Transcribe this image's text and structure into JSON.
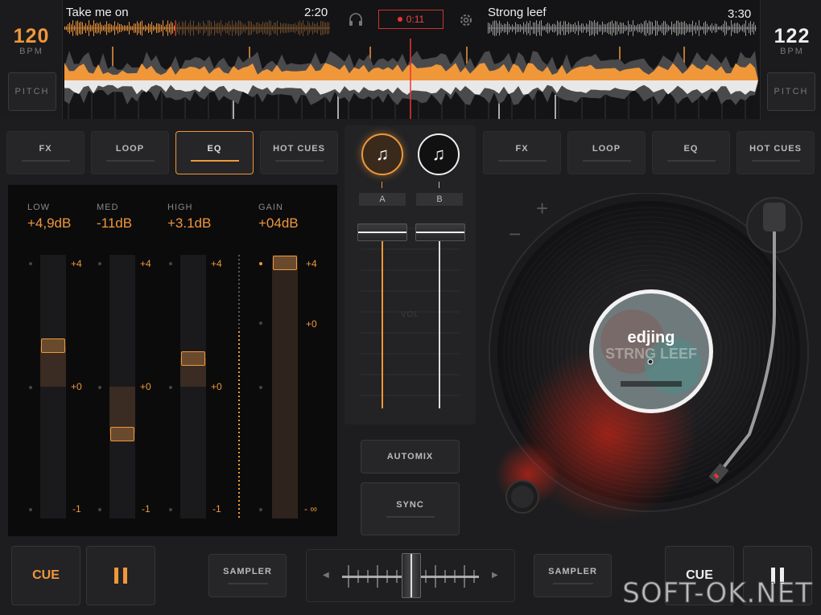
{
  "deck_left": {
    "bpm": "120",
    "bpm_label": "BPM",
    "pitch_label": "PITCH",
    "track_title": "Take me on",
    "track_time": "2:20",
    "tabs": [
      "FX",
      "LOOP",
      "EQ",
      "HOT CUES"
    ],
    "active_tab": "EQ",
    "cue_label": "CUE",
    "play_icon": "pause-icon",
    "sampler_label": "SAMPLER"
  },
  "deck_right": {
    "bpm": "122",
    "bpm_label": "BPM",
    "pitch_label": "PITCH",
    "track_title": "Strong leef",
    "track_time": "3:30",
    "tabs": [
      "FX",
      "LOOP",
      "EQ",
      "HOT CUES"
    ],
    "cue_label": "CUE",
    "play_icon": "pause-icon",
    "sampler_label": "SAMPLER",
    "record_label_brand": "edjing",
    "record_label_title": "STRNG LEEF"
  },
  "recorder": {
    "time": "0:11"
  },
  "eq": {
    "bands": [
      {
        "label": "LOW",
        "value": "+4,9dB",
        "top": "+4",
        "mid": "+0",
        "bottom": "-1"
      },
      {
        "label": "MED",
        "value": "-11dB",
        "top": "+4",
        "mid": "+0",
        "bottom": "-1"
      },
      {
        "label": "HIGH",
        "value": "+3.1dB",
        "top": "+4",
        "mid": "+0",
        "bottom": "-1"
      }
    ],
    "gain": {
      "label": "GAIN",
      "value": "+04dB",
      "top": "+4",
      "mid": "+0",
      "bottom": "- ∞"
    }
  },
  "mixer": {
    "deck_a_label": "A",
    "deck_b_label": "B",
    "volume_label": "VOL"
  },
  "center_buttons": {
    "automix": "AUTOMIX",
    "sync": "SYNC"
  },
  "turntable": {
    "plus": "+",
    "minus": "−"
  },
  "watermark": "SOFT-OK.NET",
  "colors": {
    "accent": "#f0973a",
    "record": "#e33333",
    "background": "#1d1d1f"
  }
}
